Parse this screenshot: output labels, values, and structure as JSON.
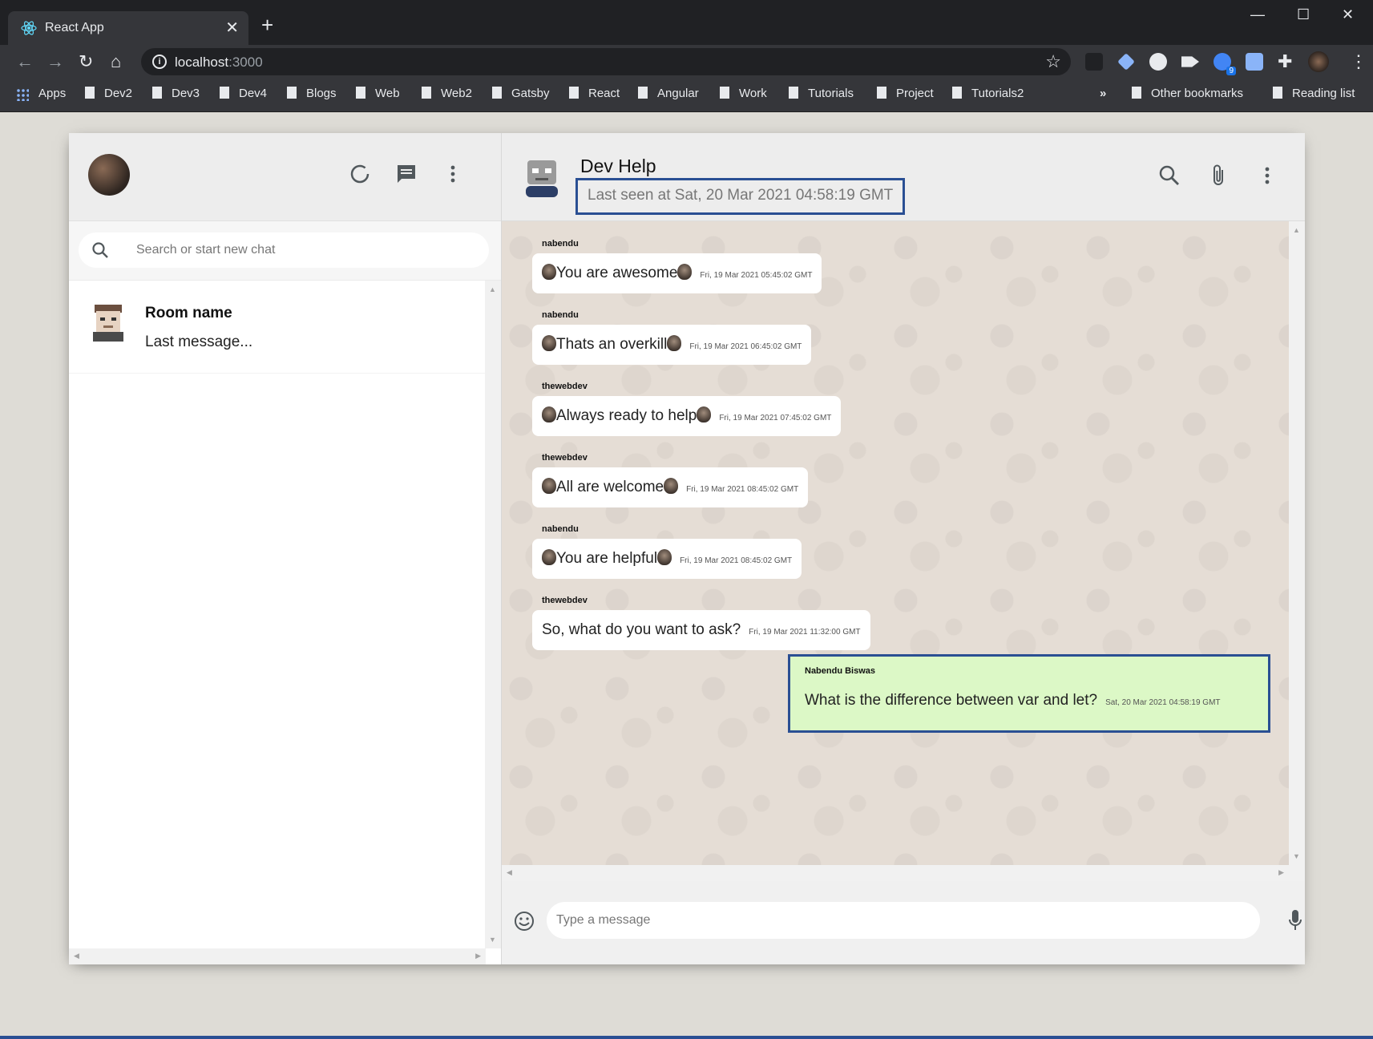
{
  "browser": {
    "tab_title": "React App",
    "url_host": "localhost",
    "url_port": ":3000",
    "bookmarks": [
      "Dev2",
      "Dev3",
      "Dev4",
      "Blogs",
      "Web",
      "Web2",
      "Gatsby",
      "React",
      "Angular",
      "Work",
      "Tutorials",
      "Project",
      "Tutorials2"
    ],
    "apps_label": "Apps",
    "more_label": "»",
    "other_bookmarks": "Other bookmarks",
    "reading_list": "Reading list",
    "extension_badge": "9"
  },
  "sidebar": {
    "search_placeholder": "Search or start new chat",
    "chats": [
      {
        "name": "Room name",
        "last_message": "Last message..."
      }
    ]
  },
  "chat": {
    "title": "Dev Help",
    "last_seen": "Last seen at Sat, 20 Mar 2021 04:58:19 GMT",
    "messages": [
      {
        "sender": "nabendu",
        "text": "You are awesome",
        "emoji": true,
        "timestamp": "Fri, 19 Mar 2021 05:45:02 GMT"
      },
      {
        "sender": "nabendu",
        "text": "Thats an overkill",
        "emoji": true,
        "timestamp": "Fri, 19 Mar 2021 06:45:02 GMT"
      },
      {
        "sender": "thewebdev",
        "text": "Always ready to help",
        "emoji": true,
        "timestamp": "Fri, 19 Mar 2021 07:45:02 GMT"
      },
      {
        "sender": "thewebdev",
        "text": "All are welcome",
        "emoji": true,
        "timestamp": "Fri, 19 Mar 2021 08:45:02 GMT"
      },
      {
        "sender": "nabendu",
        "text": "You are helpful",
        "emoji": true,
        "timestamp": "Fri, 19 Mar 2021 08:45:02 GMT"
      },
      {
        "sender": "thewebdev",
        "text": "So, what do you want to ask?",
        "emoji": false,
        "timestamp": "Fri, 19 Mar 2021 11:32:00 GMT"
      }
    ],
    "sent_message": {
      "sender": "Nabendu Biswas",
      "text": "What is the difference between var and let?",
      "timestamp": "Sat, 20 Mar 2021 04:58:19 GMT"
    },
    "input_placeholder": "Type a message"
  },
  "colors": {
    "highlight_border": "#2a4f93",
    "sent_bubble": "#dcf8c6",
    "chat_background": "#e5ddd5"
  },
  "icons": [
    "react-icon",
    "search-icon",
    "status-icon",
    "chat-icon",
    "more-vert-icon",
    "attach-icon",
    "emoji-icon",
    "mic-icon",
    "star-icon"
  ]
}
